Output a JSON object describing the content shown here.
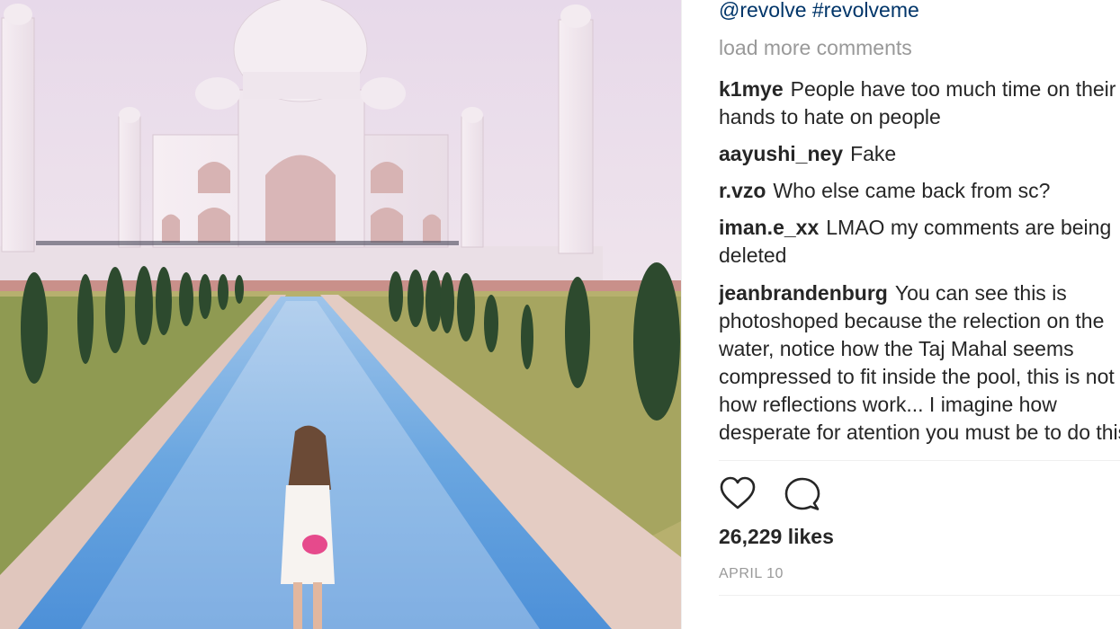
{
  "post": {
    "caption_tags": "@revolve #revolveme",
    "load_more_label": "load more comments",
    "comments": [
      {
        "user": "k1mye",
        "text": "People have too much time on their hands to hate on people"
      },
      {
        "user": "aayushi_ney",
        "text": "Fake"
      },
      {
        "user": "r.vzo",
        "text": "Who else came back from sc?"
      },
      {
        "user": "iman.e_xx",
        "text": "LMAO my comments are being deleted"
      },
      {
        "user": "jeanbrandenburg",
        "text": "You can see this is photoshoped because the relection on the water, notice how the Taj Mahal seems compressed to fit inside the pool, this is not how reflections work... I imagine how desperate for atention you must be to do this"
      }
    ],
    "likes": "26,229 likes",
    "date": "APRIL 10"
  },
  "icons": {
    "like": "heart-icon",
    "comment": "speech-bubble-icon"
  },
  "colors": {
    "text": "#262626",
    "muted": "#999999",
    "hashtag": "#003569",
    "divider": "#efefef"
  }
}
